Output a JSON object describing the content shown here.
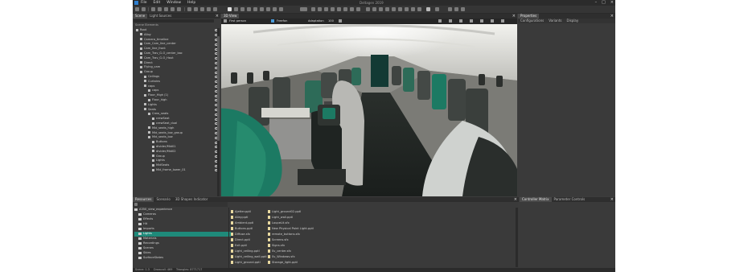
{
  "menu": [
    "File",
    "Edit",
    "Window",
    "Help"
  ],
  "window_title": "Deltagen 2019",
  "scene": {
    "tabs": [
      "Scene",
      "Light Sources"
    ],
    "search_placeholder": "",
    "root_label": "Scene Elements",
    "items": [
      {
        "label": "Root",
        "depth": 0
      },
      {
        "label": "Alloy",
        "depth": 1
      },
      {
        "label": "Camera_timeline",
        "depth": 1
      },
      {
        "label": "Cam_Cam_line_center",
        "depth": 1
      },
      {
        "label": "Cam_line_front",
        "depth": 1
      },
      {
        "label": "Cam_Trav_G-O_center_bac",
        "depth": 1
      },
      {
        "label": "Cam_Trav_G-O_Haut",
        "depth": 1
      },
      {
        "label": "Direct",
        "depth": 1
      },
      {
        "label": "Flying_cam",
        "depth": 1
      },
      {
        "label": "Group",
        "depth": 1
      },
      {
        "label": "Ceilings",
        "depth": 2
      },
      {
        "label": "Curtains",
        "depth": 2
      },
      {
        "label": "caps",
        "depth": 2
      },
      {
        "label": "caps",
        "depth": 3
      },
      {
        "label": "Floor_High (1)",
        "depth": 2
      },
      {
        "label": "Floor_high",
        "depth": 3
      },
      {
        "label": "Lights",
        "depth": 2
      },
      {
        "label": "Seats",
        "depth": 2
      },
      {
        "label": "Crew_seats",
        "depth": 3
      },
      {
        "label": "crewSeat",
        "depth": 4
      },
      {
        "label": "crewSeat_dual",
        "depth": 4
      },
      {
        "label": "Mid_seats_high",
        "depth": 3
      },
      {
        "label": "Mid_seats_low_group",
        "depth": 3
      },
      {
        "label": "Mid_seats_low",
        "depth": 3
      },
      {
        "label": "Buttons",
        "depth": 4
      },
      {
        "label": "divider/Mid01",
        "depth": 4
      },
      {
        "label": "divider/Mid02",
        "depth": 4
      },
      {
        "label": "Group",
        "depth": 4
      },
      {
        "label": "Lights",
        "depth": 4
      },
      {
        "label": "MidSeats",
        "depth": 4
      },
      {
        "label": "Mid_frame_lower_01",
        "depth": 4
      }
    ]
  },
  "viewport": {
    "tab": "3D View",
    "camera": "First person",
    "navigation": "Freefon",
    "adaptation": "Adaptation",
    "adaptation_value": "100"
  },
  "properties": {
    "tab": "Properties",
    "sub_tabs": [
      "Configurations",
      "Variants",
      "Display"
    ],
    "layout_label": "Layout",
    "layout_value": "VRPERFORMANCE"
  },
  "resources": {
    "tabs": [
      "Resources",
      "Scenario",
      "3D Shapes Indicator"
    ],
    "root": "A350_view_experience",
    "folders": [
      "Cameras",
      "Effects",
      "Hit",
      "Imports",
      "Lights",
      "Materials",
      "Recordings",
      "Scenes",
      "Skies",
      "SurfaceStates"
    ],
    "selected": "Lights",
    "files_col1": [
      "Ajetter.pptl",
      "Alley.pptl",
      "Ambient.pptl",
      "Buttons.pptl",
      "Diffuse.sfx",
      "Direct.pptl",
      "Exit.pptl",
      "Light_ceiling.pptl",
      "Light_ceiling_wall.pptl",
      "Light_ground.pptl"
    ],
    "files_col2": [
      "Light_ground02.pptl",
      "Light_wall.pptl",
      "LoupeLit.sfx",
      "New Physical Point Light.pptl",
      "remote_buttons.sfx",
      "Screens.sfx",
      "Signs.sfx",
      "Sv_center.sfx",
      "Sv_Windows.sfx",
      "Storage_light.pptl"
    ]
  },
  "controller": {
    "tabs": [
      "Controller Matrix",
      "Parameter Controls"
    ]
  },
  "status": {
    "left": "Scene: 1.3",
    "mid": "Drawcall: 469",
    "right": "Triangles: 8771717"
  },
  "colors": {
    "accent": "#1f8a7a",
    "panel": "#3a3a3a",
    "seat_green": "#1c7a63"
  }
}
